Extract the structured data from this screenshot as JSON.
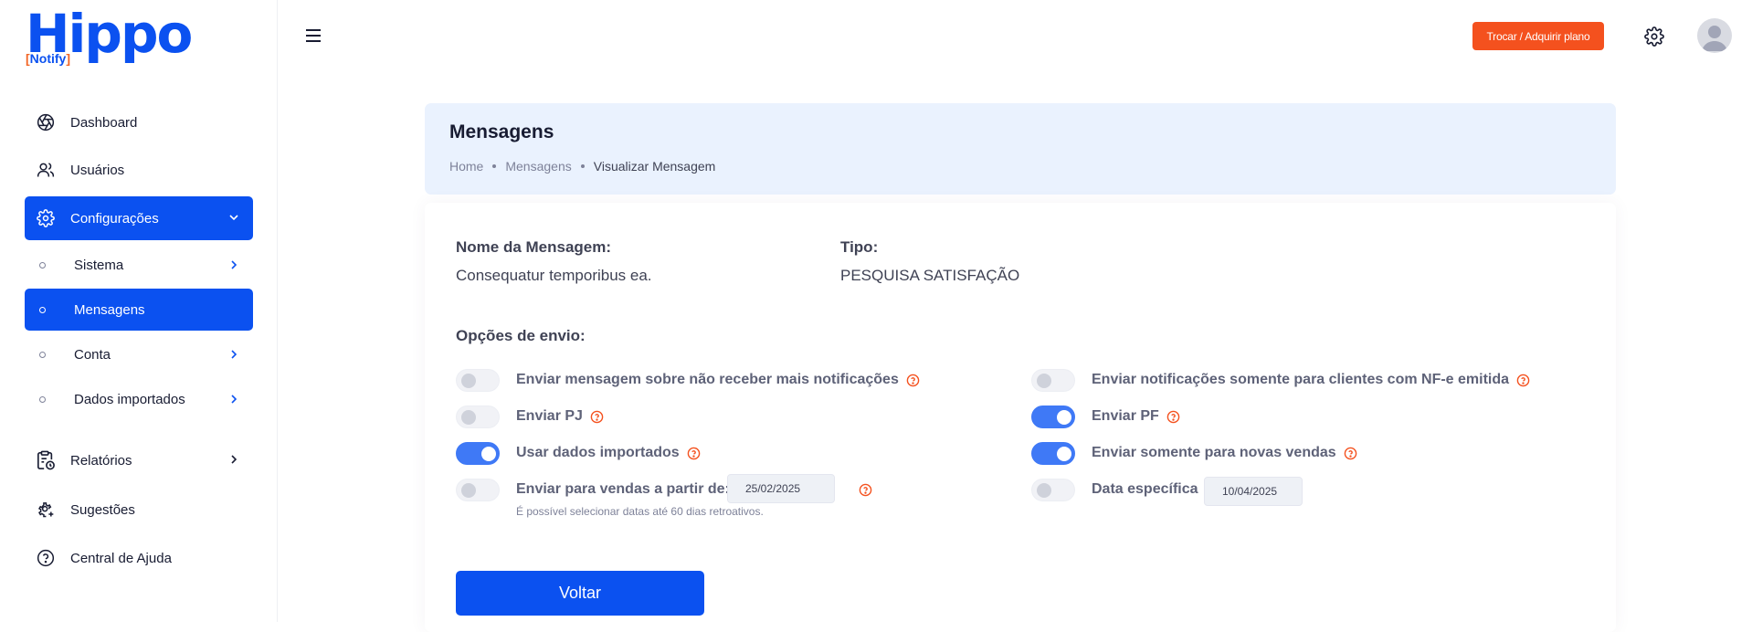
{
  "brand": {
    "name": "Hippo",
    "sub_open": "[",
    "sub": "Notify",
    "sub_close": "]"
  },
  "sidebar": {
    "items": [
      {
        "label": "Dashboard",
        "icon": "aperture-icon"
      },
      {
        "label": "Usuários",
        "icon": "users-icon"
      },
      {
        "label": "Configurações",
        "icon": "gear-icon",
        "active": true,
        "expanded": true
      },
      {
        "label": "Relatórios",
        "icon": "report-clock-icon"
      },
      {
        "label": "Sugestões",
        "icon": "gear-plus-icon"
      },
      {
        "label": "Central de Ajuda",
        "icon": "help-circle-icon"
      }
    ],
    "sub_items": [
      {
        "label": "Sistema"
      },
      {
        "label": "Mensagens",
        "active": true
      },
      {
        "label": "Conta"
      },
      {
        "label": "Dados importados"
      }
    ]
  },
  "header": {
    "plan_button": "Trocar / Adquirir plano"
  },
  "page": {
    "title": "Mensagens",
    "breadcrumb": [
      "Home",
      "Mensagens",
      "Visualizar Mensagem"
    ]
  },
  "message": {
    "name_label": "Nome da Mensagem:",
    "name_value": "Consequatur temporibus ea.",
    "type_label": "Tipo:",
    "type_value": "PESQUISA SATISFAÇÃO"
  },
  "options": {
    "title": "Opções de envio:",
    "left": [
      {
        "label": "Enviar mensagem sobre não receber mais notificações",
        "on": false
      },
      {
        "label": "Enviar PJ",
        "on": false
      },
      {
        "label": "Usar dados importados",
        "on": true
      },
      {
        "label": "Enviar para vendas a partir de:",
        "on": false,
        "date": "25/02/2025"
      }
    ],
    "right": [
      {
        "label": "Enviar notificações somente para clientes com NF-e emitida",
        "on": false
      },
      {
        "label": "Enviar PF",
        "on": true
      },
      {
        "label": "Enviar somente para novas vendas",
        "on": true
      },
      {
        "label": "Data específica",
        "on": false,
        "date": "10/04/2025"
      }
    ],
    "hint": "É possível selecionar datas até 60 dias retroativos."
  },
  "back_button": "Voltar",
  "colors": {
    "primary": "#0b51f0",
    "accent": "#f4511e",
    "toggle_on": "#3f79f6"
  }
}
